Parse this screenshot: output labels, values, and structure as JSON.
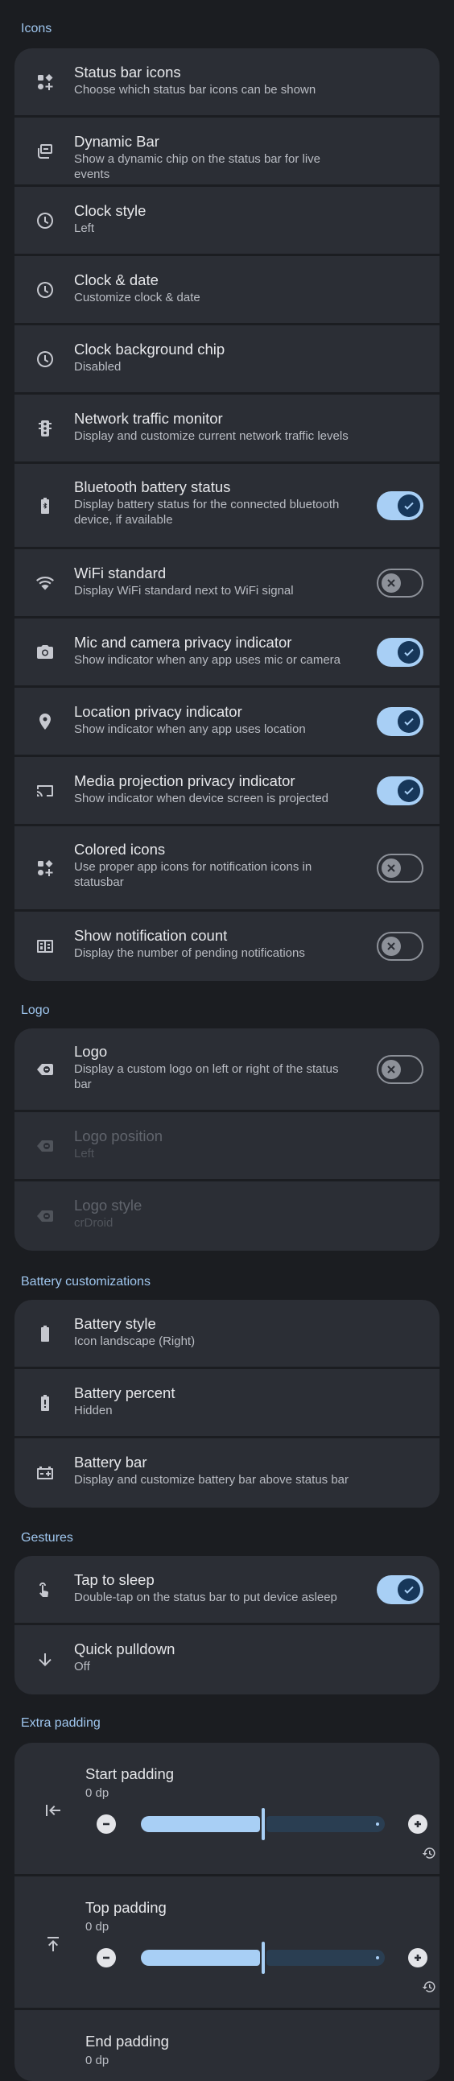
{
  "sections": {
    "icons": {
      "title": "Icons",
      "items": [
        {
          "title": "Status bar icons",
          "summary": "Choose which status bar icons can be shown",
          "icon": "status-bar-icons-icon"
        },
        {
          "title": "Dynamic Bar",
          "summary": "Show a dynamic chip on the status bar for live events",
          "icon": "dynamic-bar-icon"
        },
        {
          "title": "Clock style",
          "summary": "Left",
          "icon": "clock-icon"
        },
        {
          "title": "Clock & date",
          "summary": "Customize clock & date",
          "icon": "clock-icon"
        },
        {
          "title": "Clock background chip",
          "summary": "Disabled",
          "icon": "clock-icon"
        },
        {
          "title": "Network traffic monitor",
          "summary": "Display and customize current network traffic levels",
          "icon": "traffic-icon"
        },
        {
          "title": "Bluetooth battery status",
          "summary": "Display battery status for the connected bluetooth device, if available",
          "icon": "bluetooth-battery-icon",
          "toggle": true
        },
        {
          "title": "WiFi standard",
          "summary": "Display WiFi standard next to WiFi signal",
          "icon": "wifi-icon",
          "toggle": false
        },
        {
          "title": "Mic and camera privacy indicator",
          "summary": "Show indicator when any app uses mic or camera",
          "icon": "camera-icon",
          "toggle": true
        },
        {
          "title": "Location privacy indicator",
          "summary": "Show indicator when any app uses location",
          "icon": "location-icon",
          "toggle": true
        },
        {
          "title": "Media projection privacy indicator",
          "summary": "Show indicator when device screen is projected",
          "icon": "cast-icon",
          "toggle": true
        },
        {
          "title": "Colored icons",
          "summary": "Use proper app icons for notification icons in statusbar",
          "icon": "colored-icons-icon",
          "toggle": false
        },
        {
          "title": "Show notification count",
          "summary": "Display the number of pending notifications",
          "icon": "notification-count-icon",
          "toggle": false
        }
      ]
    },
    "logo": {
      "title": "Logo",
      "items": [
        {
          "title": "Logo",
          "summary": "Display a custom logo on left or right of the status bar",
          "icon": "logo-icon",
          "toggle": false
        },
        {
          "title": "Logo position",
          "summary": "Left",
          "icon": "logo-icon",
          "disabled": true
        },
        {
          "title": "Logo style",
          "summary": "crDroid",
          "icon": "logo-icon",
          "disabled": true
        }
      ]
    },
    "battery": {
      "title": "Battery customizations",
      "items": [
        {
          "title": "Battery style",
          "summary": "Icon landscape (Right)",
          "icon": "battery-icon"
        },
        {
          "title": "Battery percent",
          "summary": "Hidden",
          "icon": "battery-alert-icon"
        },
        {
          "title": "Battery bar",
          "summary": "Display and customize battery bar above status bar",
          "icon": "battery-bar-icon"
        }
      ]
    },
    "gestures": {
      "title": "Gestures",
      "items": [
        {
          "title": "Tap to sleep",
          "summary": "Double-tap on the status bar to put device asleep",
          "icon": "tap-icon",
          "toggle": true
        },
        {
          "title": "Quick pulldown",
          "summary": "Off",
          "icon": "arrow-down-icon"
        }
      ]
    },
    "padding": {
      "title": "Extra padding",
      "items": [
        {
          "title": "Start padding",
          "value": "0 dp",
          "level": 0.5,
          "icon": "start-padding-icon"
        },
        {
          "title": "Top padding",
          "value": "0 dp",
          "level": 0.5,
          "icon": "top-padding-icon"
        },
        {
          "title": "End padding",
          "value": "0 dp",
          "icon": "end-padding-icon"
        }
      ]
    }
  },
  "colors": {
    "background": "#1b1d21",
    "card": "#2b2e35",
    "accent": "#a8cff5",
    "section_title": "#9fc6ee"
  }
}
